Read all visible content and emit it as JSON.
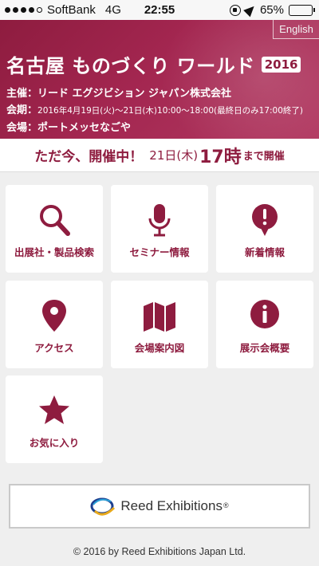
{
  "status_bar": {
    "carrier": "SoftBank",
    "network": "4G",
    "time": "22:55",
    "battery": "65%",
    "battery_level": 0.65
  },
  "header": {
    "english_label": "English",
    "title": "名古屋 ものづくり ワールド",
    "year": "2016",
    "organizer": "主催：リード エグジビション ジャパン株式会社",
    "period_label": "会期：",
    "period_dates": "2016年4月19日(火)～21日(木)10:00～18:00",
    "period_note": "(最終日のみ17:00終了)",
    "venue": "会場：ポートメッセなごや"
  },
  "banner": {
    "status": "ただ今、開催中！",
    "date": "21日(木)",
    "hour": "17時",
    "suffix": "まで開催"
  },
  "menu": [
    {
      "label": "出展社・製品検索",
      "icon": "search-icon"
    },
    {
      "label": "セミナー情報",
      "icon": "microphone-icon"
    },
    {
      "label": "新着情報",
      "icon": "alert-bubble-icon"
    },
    {
      "label": "アクセス",
      "icon": "map-pin-icon"
    },
    {
      "label": "会場案内図",
      "icon": "map-icon"
    },
    {
      "label": "展示会概要",
      "icon": "info-icon"
    },
    {
      "label": "お気に入り",
      "icon": "star-icon"
    }
  ],
  "reed": {
    "name": "Reed Exhibitions",
    "mark": "®"
  },
  "footer": {
    "copyright": "© 2016 by Reed Exhibitions Japan Ltd."
  },
  "colors": {
    "accent": "#8e1c3f",
    "background": "#efefef",
    "battery": "#4cd964"
  }
}
